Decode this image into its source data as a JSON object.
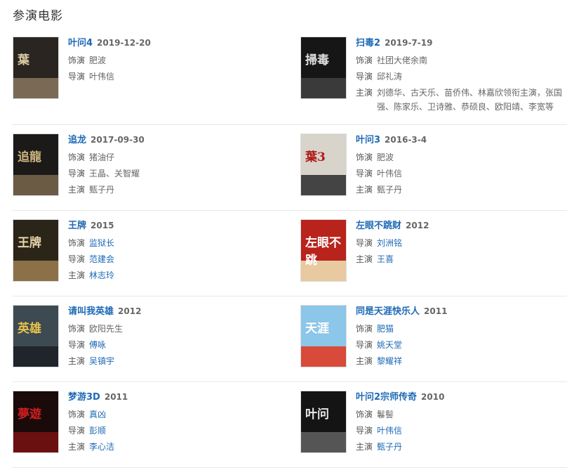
{
  "section": {
    "title": "参演电影"
  },
  "labels": {
    "role": "饰演",
    "director": "导演",
    "cast": "主演"
  },
  "movies": [
    {
      "title": "叶问4",
      "year": "2019-12-20",
      "role": "肥波",
      "role_link": false,
      "director": "叶伟信",
      "director_link": false,
      "cast": "",
      "cast_link": false,
      "poster": {
        "bg": "#2a2520",
        "band": "#7a6a55",
        "glyph": "葉",
        "glyph_color": "#d9c9a3"
      }
    },
    {
      "title": "扫毒2",
      "year": "2019-7-19",
      "role": "社团大佬余南",
      "role_link": false,
      "director": "邱礼涛",
      "director_link": false,
      "cast": "刘德华、古天乐、苗侨伟、林嘉欣领衔主演，张国强、陈家乐、卫诗雅、恭硕良、欧阳靖、李宽等",
      "cast_link": false,
      "poster": {
        "bg": "#161616",
        "band": "#3a3a3a",
        "glyph": "掃毒",
        "glyph_color": "#e0e0e0"
      }
    },
    {
      "title": "追龙",
      "year": "2017-09-30",
      "role": "猪油仔",
      "role_link": false,
      "director": "王晶、关智耀",
      "director_link": false,
      "cast": "甄子丹",
      "cast_link": false,
      "poster": {
        "bg": "#1c1a18",
        "band": "#6b5a44",
        "glyph": "追龍",
        "glyph_color": "#c9b27e"
      }
    },
    {
      "title": "叶问3",
      "year": "2016-3-4",
      "role": "肥波",
      "role_link": false,
      "director": "叶伟信",
      "director_link": false,
      "cast": "甄子丹",
      "cast_link": false,
      "poster": {
        "bg": "#d8d4cc",
        "band": "#444",
        "glyph": "葉3",
        "glyph_color": "#b01818"
      }
    },
    {
      "title": "王牌",
      "year": "2015",
      "role": "监狱长",
      "role_link": true,
      "director": "范建会",
      "director_link": true,
      "cast": "林志玲",
      "cast_link": true,
      "poster": {
        "bg": "#2b2418",
        "band": "#8c7048",
        "glyph": "王牌",
        "glyph_color": "#e8d6a8"
      }
    },
    {
      "title": "左眼不跳财",
      "year": "2012",
      "role": "",
      "role_link": false,
      "director": "刘洲铭",
      "director_link": true,
      "cast": "王喜",
      "cast_link": true,
      "poster": {
        "bg": "#b8231c",
        "band": "#e8c9a0",
        "glyph": "左眼不跳",
        "glyph_color": "#ffffff"
      }
    },
    {
      "title": "请叫我英雄",
      "year": "2012",
      "role": "欧阳先生",
      "role_link": false,
      "director": "傅咏",
      "director_link": true,
      "cast": "吴镇宇",
      "cast_link": true,
      "poster": {
        "bg": "#3d4a52",
        "band": "#1f252a",
        "glyph": "英雄",
        "glyph_color": "#e8c24a"
      }
    },
    {
      "title": "同是天涯快乐人",
      "year": "2011",
      "role": "肥猫",
      "role_link": true,
      "director": "姚天堂",
      "director_link": true,
      "cast": "黎耀祥",
      "cast_link": true,
      "poster": {
        "bg": "#8cc6e8",
        "band": "#d84a3a",
        "glyph": "天涯",
        "glyph_color": "#ffffff"
      }
    },
    {
      "title": "梦游3D",
      "year": "2011",
      "role": "真凶",
      "role_link": true,
      "director": "彭顺",
      "director_link": true,
      "cast": "李心洁",
      "cast_link": true,
      "poster": {
        "bg": "#1a0a0a",
        "band": "#6a1010",
        "glyph": "夢遊",
        "glyph_color": "#d21e1e"
      }
    },
    {
      "title": "叶问2宗师传奇",
      "year": "2010",
      "role": "鬈髻",
      "role_link": false,
      "director": "叶伟信",
      "director_link": true,
      "cast": "甄子丹",
      "cast_link": true,
      "poster": {
        "bg": "#141414",
        "band": "#555",
        "glyph": "叶问",
        "glyph_color": "#e8e8e8"
      }
    }
  ]
}
